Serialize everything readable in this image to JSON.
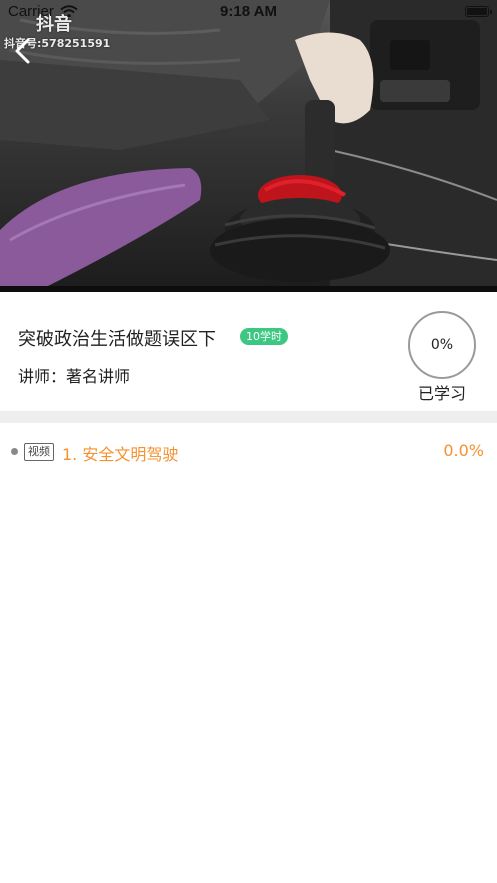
{
  "status_bar": {
    "carrier": "Carrier",
    "time": "9:18 AM"
  },
  "video": {
    "watermark_logo": "抖音",
    "watermark_id": "抖音号:578251591"
  },
  "course": {
    "title": "突破政治生活做题误区下",
    "hours_badge": "10学时",
    "teacher": "讲师：著名讲师",
    "progress_percent": "0%",
    "progress_label": "已学习"
  },
  "lessons": [
    {
      "type_tag": "视频",
      "title": "1. 安全文明驾驶",
      "progress": "0.0%"
    }
  ],
  "colors": {
    "accent_orange": "#f5922f",
    "badge_green": "#3cc882",
    "divider_gray": "#eeeeee"
  },
  "icons": {
    "back": "chevron-left-icon",
    "wifi": "wifi-icon",
    "battery": "battery-icon"
  }
}
